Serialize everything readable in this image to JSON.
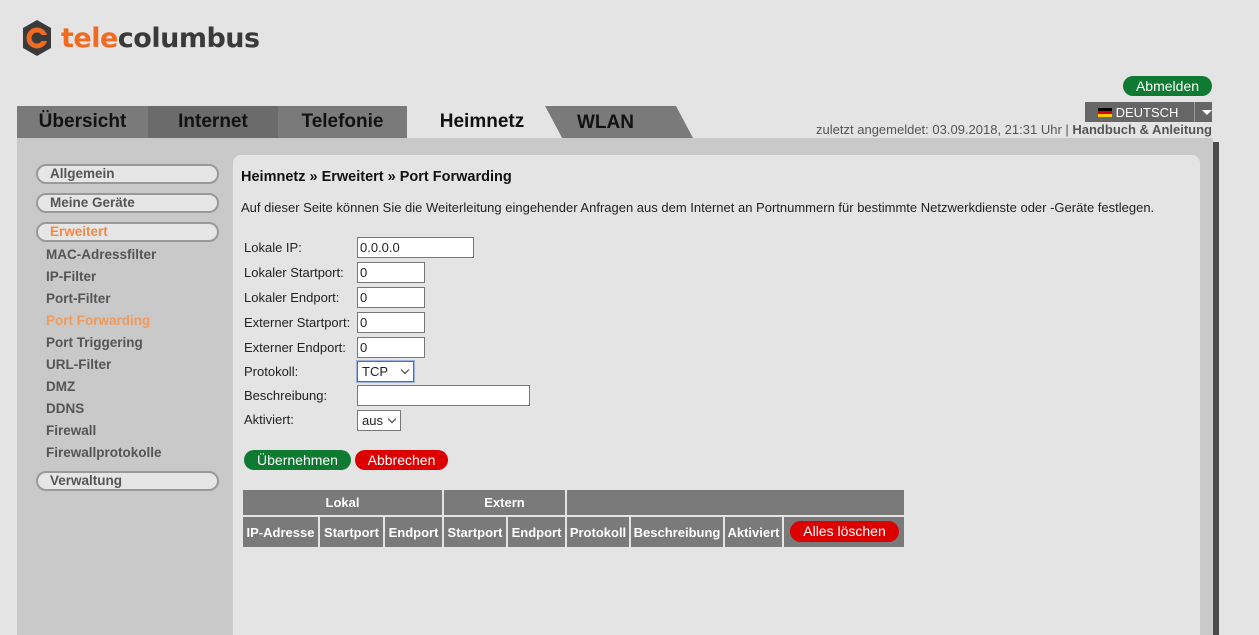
{
  "brand": {
    "tele": "tele",
    "columbus": "columbus",
    "accent": "#f06a1f"
  },
  "header": {
    "logout_label": "Abmelden",
    "language_label": "DEUTSCH",
    "last_login_text": "zuletzt angemeldet: 03.09.2018, 21:31 Uhr | ",
    "manual_link": "Handbuch & Anleitung"
  },
  "tabs": [
    {
      "label": "Übersicht"
    },
    {
      "label": "Internet"
    },
    {
      "label": "Telefonie"
    },
    {
      "label": "Heimnetz",
      "active": true
    },
    {
      "label": "WLAN"
    }
  ],
  "sidebar": {
    "sections": [
      {
        "label": "Allgemein"
      },
      {
        "label": "Meine Geräte"
      },
      {
        "label": "Erweitert",
        "active": true
      },
      {
        "label": "Verwaltung"
      }
    ],
    "sub_items": [
      {
        "label": "MAC-Adressfilter"
      },
      {
        "label": "IP-Filter"
      },
      {
        "label": "Port-Filter"
      },
      {
        "label": "Port Forwarding",
        "active": true
      },
      {
        "label": "Port Triggering"
      },
      {
        "label": "URL-Filter"
      },
      {
        "label": "DMZ"
      },
      {
        "label": "DDNS"
      },
      {
        "label": "Firewall"
      },
      {
        "label": "Firewallprotokolle"
      }
    ]
  },
  "main": {
    "breadcrumb": "Heimnetz » Erweitert » Port Forwarding",
    "description": "Auf dieser Seite können Sie die Weiterleitung eingehender Anfragen aus dem Internet an Portnummern für bestimmte Netzwerkdienste oder -Geräte festlegen.",
    "form": {
      "local_ip": {
        "label": "Lokale IP:",
        "value": "0.0.0.0"
      },
      "local_start": {
        "label": "Lokaler Startport:",
        "value": "0"
      },
      "local_end": {
        "label": "Lokaler Endport:",
        "value": "0"
      },
      "ext_start": {
        "label": "Externer Startport:",
        "value": "0"
      },
      "ext_end": {
        "label": "Externer Endport:",
        "value": "0"
      },
      "protocol": {
        "label": "Protokoll:",
        "value": "TCP"
      },
      "description": {
        "label": "Beschreibung:",
        "value": ""
      },
      "enabled": {
        "label": "Aktiviert:",
        "value": "aus"
      }
    },
    "apply_label": "Übernehmen",
    "cancel_label": "Abbrechen",
    "table": {
      "group_local": "Lokal",
      "group_external": "Extern",
      "columns": [
        "IP-Adresse",
        "Startport",
        "Endport",
        "Startport",
        "Endport",
        "Protokoll",
        "Beschreibung",
        "Aktiviert"
      ],
      "clear_all_label": "Alles löschen"
    }
  }
}
